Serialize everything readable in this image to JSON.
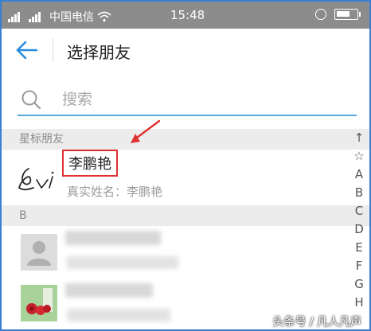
{
  "status_bar": {
    "carrier": "中国电信",
    "time": "15:48"
  },
  "header": {
    "title": "选择朋友"
  },
  "search": {
    "placeholder": "搜索"
  },
  "sections": {
    "starred": "星标朋友",
    "b": "B"
  },
  "contacts": {
    "starred_contact": {
      "name": "李鹏艳",
      "real_name_label": "真实姓名：李鹏艳"
    }
  },
  "index_bar": [
    "↑",
    "☆",
    "A",
    "B",
    "C",
    "D",
    "E",
    "F",
    "G",
    "H"
  ],
  "watermark": "头条号 / 凡人凡声",
  "colors": {
    "accent": "#2a8ee0",
    "highlight_box": "#e03030",
    "status_bar": "#8c8c8c"
  }
}
